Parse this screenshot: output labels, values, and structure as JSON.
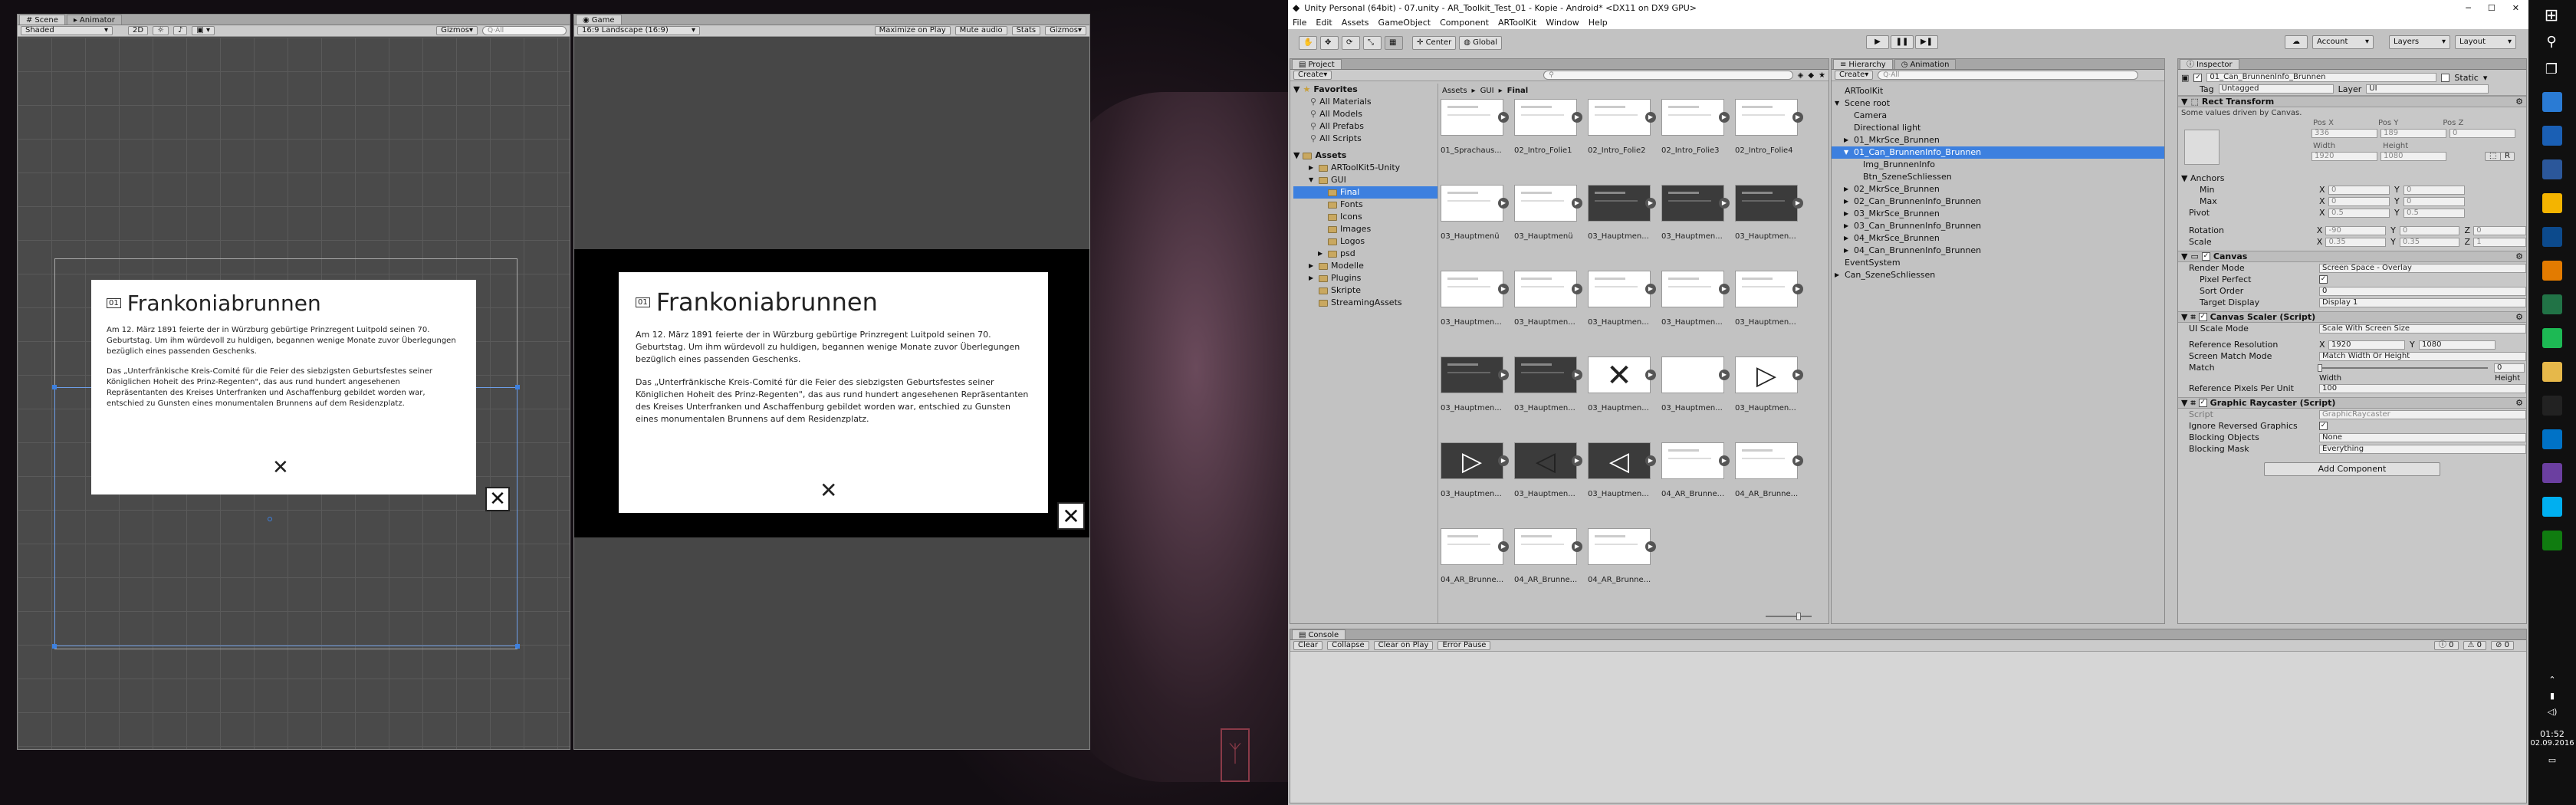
{
  "title_bar": "Unity Personal (64bit) - 07.unity - AR_Toolkit_Test_01 - Kopie - Android* <DX11 on DX9 GPU>",
  "menu": [
    "File",
    "Edit",
    "Assets",
    "GameObject",
    "Component",
    "ARToolKit",
    "Window",
    "Help"
  ],
  "toolbar": {
    "center": "Center",
    "global": "Global",
    "account": "Account",
    "layers": "Layers",
    "layout": "Layout"
  },
  "scene_view": {
    "tabs": [
      "Scene",
      "Animator"
    ],
    "shaded": "Shaded",
    "mode_2d": "2D",
    "gizmos": "Gizmos",
    "search_placeholder": "Q·All"
  },
  "game_view": {
    "tab": "Game",
    "resolution": "16:9 Landscape (16:9)",
    "maximize": "Maximize on Play",
    "mute": "Mute audio",
    "stats": "Stats",
    "gizmos": "Gizmos"
  },
  "info_card": {
    "number": "01",
    "title": "Frankoniabrunnen",
    "para1": "Am 12. März 1891 feierte der in Würzburg gebürtige Prinzregent Luitpold seinen 70. Geburtstag. Um ihm würdevoll zu huldigen, begannen wenige Monate zuvor Überlegungen bezüglich eines passenden Geschenks.",
    "para2": "Das „Unterfränkische Kreis-Comité für die Feier des siebzigsten Geburtsfestes seiner Königlichen Hoheit des Prinz-Regenten\", das aus rund hundert angesehenen Repräsentanten des Kreises Unterfranken und Aschaffenburg gebildet worden war, entschied zu Gunsten eines monumentalen Brunnens auf dem Residenzplatz.",
    "close_glyph": "✕"
  },
  "project": {
    "tab": "Project",
    "create": "Create",
    "breadcrumb": [
      "Assets",
      "GUI",
      "Final"
    ],
    "favorites_label": "Favorites",
    "favorites": [
      "All Materials",
      "All Models",
      "All Prefabs",
      "All Scripts"
    ],
    "assets_label": "Assets",
    "tree": [
      {
        "name": "ARToolKit5-Unity",
        "level": 1,
        "arrow": "▶"
      },
      {
        "name": "GUI",
        "level": 1,
        "arrow": "▼"
      },
      {
        "name": "Final",
        "level": 2,
        "arrow": "",
        "selected": true
      },
      {
        "name": "Fonts",
        "level": 2,
        "arrow": ""
      },
      {
        "name": "Icons",
        "level": 2,
        "arrow": ""
      },
      {
        "name": "Images",
        "level": 2,
        "arrow": ""
      },
      {
        "name": "Logos",
        "level": 2,
        "arrow": ""
      },
      {
        "name": "psd",
        "level": 2,
        "arrow": "▶"
      },
      {
        "name": "Modelle",
        "level": 1,
        "arrow": "▶"
      },
      {
        "name": "Plugins",
        "level": 1,
        "arrow": "▶"
      },
      {
        "name": "Skripte",
        "level": 1,
        "arrow": ""
      },
      {
        "name": "StreamingAssets",
        "level": 1,
        "arrow": ""
      }
    ],
    "grid": [
      "01_Sprachaus...",
      "02_Intro_Folie1",
      "02_Intro_Folie2",
      "02_Intro_Folie3",
      "02_Intro_Folie4",
      "03_Hauptmenü",
      "03_Hauptmenü",
      "03_Hauptmen...",
      "03_Hauptmen...",
      "03_Hauptmen...",
      "03_Hauptmen...",
      "03_Hauptmen...",
      "03_Hauptmen...",
      "03_Hauptmen...",
      "03_Hauptmen...",
      "03_Hauptmen...",
      "03_Hauptmen...",
      "03_Hauptmen...",
      "03_Hauptmen...",
      "03_Hauptmen...",
      "03_Hauptmen...",
      "03_Hauptmen...",
      "03_Hauptmen...",
      "04_AR_Brunne...",
      "04_AR_Brunne...",
      "04_AR_Brunne...",
      "04_AR_Brunne...",
      "04_AR_Brunne..."
    ]
  },
  "hierarchy": {
    "tab": "Hierarchy",
    "tab2": "Animation",
    "create": "Create",
    "search_placeholder": "Q·All",
    "items": [
      {
        "name": "ARToolKit",
        "level": 0,
        "arrow": ""
      },
      {
        "name": "Scene root",
        "level": 0,
        "arrow": "▼"
      },
      {
        "name": "Camera",
        "level": 1,
        "arrow": ""
      },
      {
        "name": "Directional light",
        "level": 1,
        "arrow": ""
      },
      {
        "name": "01_MkrSce_Brunnen",
        "level": 1,
        "arrow": "▶"
      },
      {
        "name": "01_Can_BrunnenInfo_Brunnen",
        "level": 1,
        "arrow": "▼",
        "selected": true
      },
      {
        "name": "Img_BrunnenInfo",
        "level": 2,
        "arrow": ""
      },
      {
        "name": "Btn_SzeneSchliessen",
        "level": 2,
        "arrow": ""
      },
      {
        "name": "02_MkrSce_Brunnen",
        "level": 1,
        "arrow": "▶"
      },
      {
        "name": "02_Can_BrunnenInfo_Brunnen",
        "level": 1,
        "arrow": "▶"
      },
      {
        "name": "03_MkrSce_Brunnen",
        "level": 1,
        "arrow": "▶"
      },
      {
        "name": "03_Can_BrunnenInfo_Brunnen",
        "level": 1,
        "arrow": "▶"
      },
      {
        "name": "04_MkrSce_Brunnen",
        "level": 1,
        "arrow": "▶"
      },
      {
        "name": "04_Can_BrunnenInfo_Brunnen",
        "level": 1,
        "arrow": "▶"
      },
      {
        "name": "EventSystem",
        "level": 0,
        "arrow": ""
      },
      {
        "name": "Can_SzeneSchliessen",
        "level": 0,
        "arrow": "▶"
      }
    ]
  },
  "inspector": {
    "tab": "Inspector",
    "object_name": "01_Can_BrunnenInfo_Brunnen",
    "static_label": "Static",
    "tag_label": "Tag",
    "tag": "Untagged",
    "layer_label": "Layer",
    "layer": "UI",
    "rect_transform": "Rect Transform",
    "driven_note": "Some values driven by Canvas.",
    "pos_headers": [
      "Pos X",
      "Pos Y",
      "Pos Z"
    ],
    "pos_values": [
      "336",
      "189",
      "0"
    ],
    "size_headers": [
      "Width",
      "Height"
    ],
    "size_values": [
      "1920",
      "1080"
    ],
    "anchors": "Anchors",
    "min_label": "Min",
    "max_label": "Max",
    "pivot_label": "Pivot",
    "rotation_label": "Rotation",
    "scale_label": "Scale",
    "x": "X",
    "y": "Y",
    "z": "Z",
    "anchor_min": [
      "0",
      "0"
    ],
    "anchor_max": [
      "0",
      "0"
    ],
    "pivot": [
      "0.5",
      "0.5"
    ],
    "rotation": [
      "-90",
      "0",
      "0"
    ],
    "scale": [
      "0.35",
      "0.35",
      "1"
    ],
    "canvas": "Canvas",
    "render_mode_label": "Render Mode",
    "render_mode": "Screen Space - Overlay",
    "pixel_perfect": "Pixel Perfect",
    "sort_order_label": "Sort Order",
    "sort_order": "0",
    "target_display_label": "Target Display",
    "target_display": "Display 1",
    "canvas_scaler": "Canvas Scaler (Script)",
    "ui_scale_mode_label": "UI Scale Mode",
    "ui_scale_mode": "Scale With Screen Size",
    "ref_res_label": "Reference Resolution",
    "ref_res": [
      "1920",
      "1080"
    ],
    "screen_match_label": "Screen Match Mode",
    "screen_match": "Match Width Or Height",
    "match_label": "Match",
    "match_value": "0",
    "width_label": "Width",
    "height_label": "Height",
    "ref_ppu_label": "Reference Pixels Per Unit",
    "ref_ppu": "100",
    "graphic_raycaster": "Graphic Raycaster (Script)",
    "script_label": "Script",
    "script_value": "GraphicRaycaster",
    "ignore_reversed": "Ignore Reversed Graphics",
    "blocking_objects_label": "Blocking Objects",
    "blocking_objects": "None",
    "blocking_mask_label": "Blocking Mask",
    "blocking_mask": "Everything",
    "add_component": "Add Component"
  },
  "console": {
    "tab": "Console",
    "buttons": [
      "Clear",
      "Collapse",
      "Clear on Play",
      "Error Pause"
    ],
    "counts": [
      "0",
      "0",
      "0"
    ]
  },
  "taskbar": {
    "time": "01:52",
    "date": "02.09.2016",
    "icons": [
      "settings-icon",
      "mail-icon",
      "word-icon",
      "chrome-icon",
      "photoshop-icon",
      "illustrator-icon",
      "excel-icon",
      "spotify-icon",
      "folder-icon",
      "unity-icon",
      "outlook-icon",
      "media-icon",
      "skype-icon",
      "xbox-icon"
    ],
    "icon_colors": [
      "#2a7bd4",
      "#1a5fb4",
      "#2b579a",
      "#f4b400",
      "#0c4a8c",
      "#e37b00",
      "#217346",
      "#1db954",
      "#e6b84a",
      "#222",
      "#0072c6",
      "#6b3fa0",
      "#00aff0",
      "#107c10"
    ]
  },
  "colors": {
    "selection": "#3d80df",
    "panel": "#c2c2c2"
  }
}
